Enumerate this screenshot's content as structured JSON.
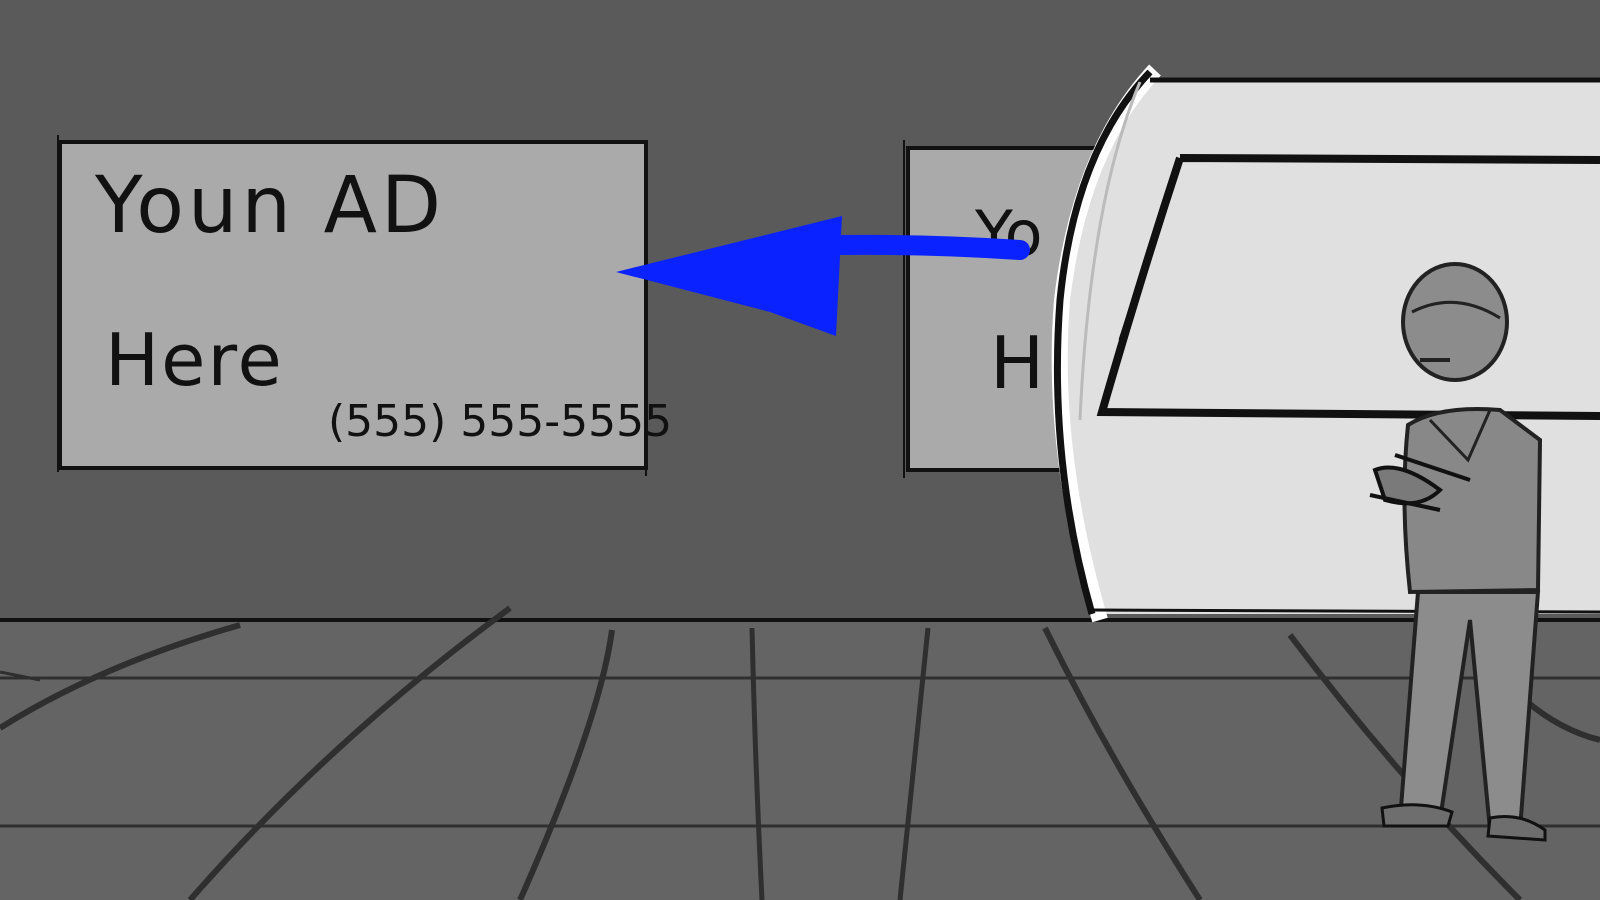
{
  "colors": {
    "wall": "#5a5a5a",
    "floor": "#646464",
    "billboard": "#aaaaaa",
    "train": "#e0e0e0",
    "arrow": "#0a22ff",
    "figure": "#8c8c8c",
    "ink": "#111111"
  },
  "billboard_left": {
    "line1": "Youn AD",
    "line2": "Here",
    "phone": "(555) 555-5555"
  },
  "billboard_right": {
    "line1_partial": "Yo",
    "line2_partial": "H"
  },
  "arrow": {
    "direction": "left",
    "meaning": "camera pan"
  }
}
